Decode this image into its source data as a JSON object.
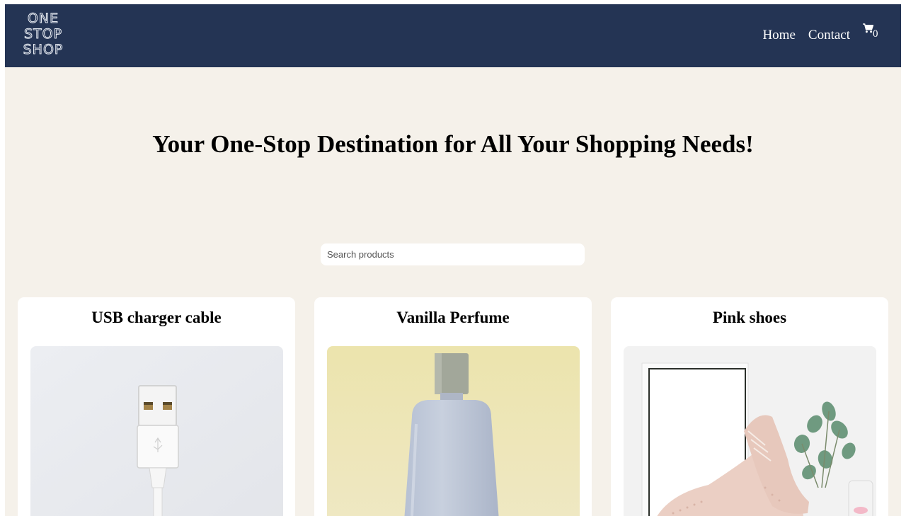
{
  "brand": {
    "logo_lines": [
      "ONE",
      "STOP",
      "SHOP"
    ]
  },
  "nav": {
    "home": "Home",
    "contact": "Contact",
    "cart_icon": "shopping-cart-icon",
    "cart_count": "0"
  },
  "hero": {
    "title": "Your One-Stop Destination for All Your Shopping Needs!"
  },
  "search": {
    "placeholder": "Search products",
    "value": ""
  },
  "products": [
    {
      "name": "USB charger cable",
      "image": "usb-cable-photo"
    },
    {
      "name": "Vanilla Perfume",
      "image": "perfume-bottle-photo"
    },
    {
      "name": "Pink shoes",
      "image": "pink-shoes-photo"
    }
  ],
  "colors": {
    "navbar": "#243454",
    "page_background": "#f5f1ea",
    "card_background": "#ffffff"
  }
}
